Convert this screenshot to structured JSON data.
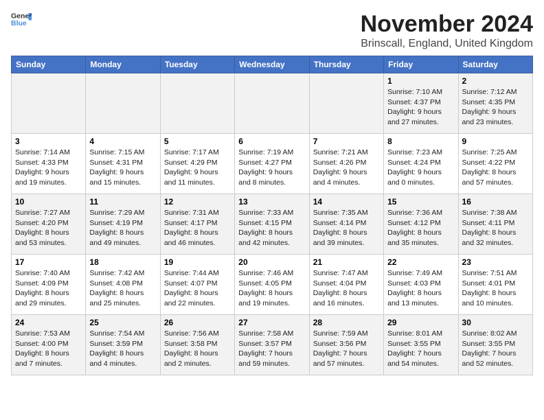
{
  "header": {
    "logo_general": "General",
    "logo_blue": "Blue",
    "month_title": "November 2024",
    "location": "Brinscall, England, United Kingdom"
  },
  "weekdays": [
    "Sunday",
    "Monday",
    "Tuesday",
    "Wednesday",
    "Thursday",
    "Friday",
    "Saturday"
  ],
  "weeks": [
    [
      {
        "day": "",
        "info": ""
      },
      {
        "day": "",
        "info": ""
      },
      {
        "day": "",
        "info": ""
      },
      {
        "day": "",
        "info": ""
      },
      {
        "day": "",
        "info": ""
      },
      {
        "day": "1",
        "info": "Sunrise: 7:10 AM\nSunset: 4:37 PM\nDaylight: 9 hours\nand 27 minutes."
      },
      {
        "day": "2",
        "info": "Sunrise: 7:12 AM\nSunset: 4:35 PM\nDaylight: 9 hours\nand 23 minutes."
      }
    ],
    [
      {
        "day": "3",
        "info": "Sunrise: 7:14 AM\nSunset: 4:33 PM\nDaylight: 9 hours\nand 19 minutes."
      },
      {
        "day": "4",
        "info": "Sunrise: 7:15 AM\nSunset: 4:31 PM\nDaylight: 9 hours\nand 15 minutes."
      },
      {
        "day": "5",
        "info": "Sunrise: 7:17 AM\nSunset: 4:29 PM\nDaylight: 9 hours\nand 11 minutes."
      },
      {
        "day": "6",
        "info": "Sunrise: 7:19 AM\nSunset: 4:27 PM\nDaylight: 9 hours\nand 8 minutes."
      },
      {
        "day": "7",
        "info": "Sunrise: 7:21 AM\nSunset: 4:26 PM\nDaylight: 9 hours\nand 4 minutes."
      },
      {
        "day": "8",
        "info": "Sunrise: 7:23 AM\nSunset: 4:24 PM\nDaylight: 9 hours\nand 0 minutes."
      },
      {
        "day": "9",
        "info": "Sunrise: 7:25 AM\nSunset: 4:22 PM\nDaylight: 8 hours\nand 57 minutes."
      }
    ],
    [
      {
        "day": "10",
        "info": "Sunrise: 7:27 AM\nSunset: 4:20 PM\nDaylight: 8 hours\nand 53 minutes."
      },
      {
        "day": "11",
        "info": "Sunrise: 7:29 AM\nSunset: 4:19 PM\nDaylight: 8 hours\nand 49 minutes."
      },
      {
        "day": "12",
        "info": "Sunrise: 7:31 AM\nSunset: 4:17 PM\nDaylight: 8 hours\nand 46 minutes."
      },
      {
        "day": "13",
        "info": "Sunrise: 7:33 AM\nSunset: 4:15 PM\nDaylight: 8 hours\nand 42 minutes."
      },
      {
        "day": "14",
        "info": "Sunrise: 7:35 AM\nSunset: 4:14 PM\nDaylight: 8 hours\nand 39 minutes."
      },
      {
        "day": "15",
        "info": "Sunrise: 7:36 AM\nSunset: 4:12 PM\nDaylight: 8 hours\nand 35 minutes."
      },
      {
        "day": "16",
        "info": "Sunrise: 7:38 AM\nSunset: 4:11 PM\nDaylight: 8 hours\nand 32 minutes."
      }
    ],
    [
      {
        "day": "17",
        "info": "Sunrise: 7:40 AM\nSunset: 4:09 PM\nDaylight: 8 hours\nand 29 minutes."
      },
      {
        "day": "18",
        "info": "Sunrise: 7:42 AM\nSunset: 4:08 PM\nDaylight: 8 hours\nand 25 minutes."
      },
      {
        "day": "19",
        "info": "Sunrise: 7:44 AM\nSunset: 4:07 PM\nDaylight: 8 hours\nand 22 minutes."
      },
      {
        "day": "20",
        "info": "Sunrise: 7:46 AM\nSunset: 4:05 PM\nDaylight: 8 hours\nand 19 minutes."
      },
      {
        "day": "21",
        "info": "Sunrise: 7:47 AM\nSunset: 4:04 PM\nDaylight: 8 hours\nand 16 minutes."
      },
      {
        "day": "22",
        "info": "Sunrise: 7:49 AM\nSunset: 4:03 PM\nDaylight: 8 hours\nand 13 minutes."
      },
      {
        "day": "23",
        "info": "Sunrise: 7:51 AM\nSunset: 4:01 PM\nDaylight: 8 hours\nand 10 minutes."
      }
    ],
    [
      {
        "day": "24",
        "info": "Sunrise: 7:53 AM\nSunset: 4:00 PM\nDaylight: 8 hours\nand 7 minutes."
      },
      {
        "day": "25",
        "info": "Sunrise: 7:54 AM\nSunset: 3:59 PM\nDaylight: 8 hours\nand 4 minutes."
      },
      {
        "day": "26",
        "info": "Sunrise: 7:56 AM\nSunset: 3:58 PM\nDaylight: 8 hours\nand 2 minutes."
      },
      {
        "day": "27",
        "info": "Sunrise: 7:58 AM\nSunset: 3:57 PM\nDaylight: 7 hours\nand 59 minutes."
      },
      {
        "day": "28",
        "info": "Sunrise: 7:59 AM\nSunset: 3:56 PM\nDaylight: 7 hours\nand 57 minutes."
      },
      {
        "day": "29",
        "info": "Sunrise: 8:01 AM\nSunset: 3:55 PM\nDaylight: 7 hours\nand 54 minutes."
      },
      {
        "day": "30",
        "info": "Sunrise: 8:02 AM\nSunset: 3:55 PM\nDaylight: 7 hours\nand 52 minutes."
      }
    ]
  ]
}
